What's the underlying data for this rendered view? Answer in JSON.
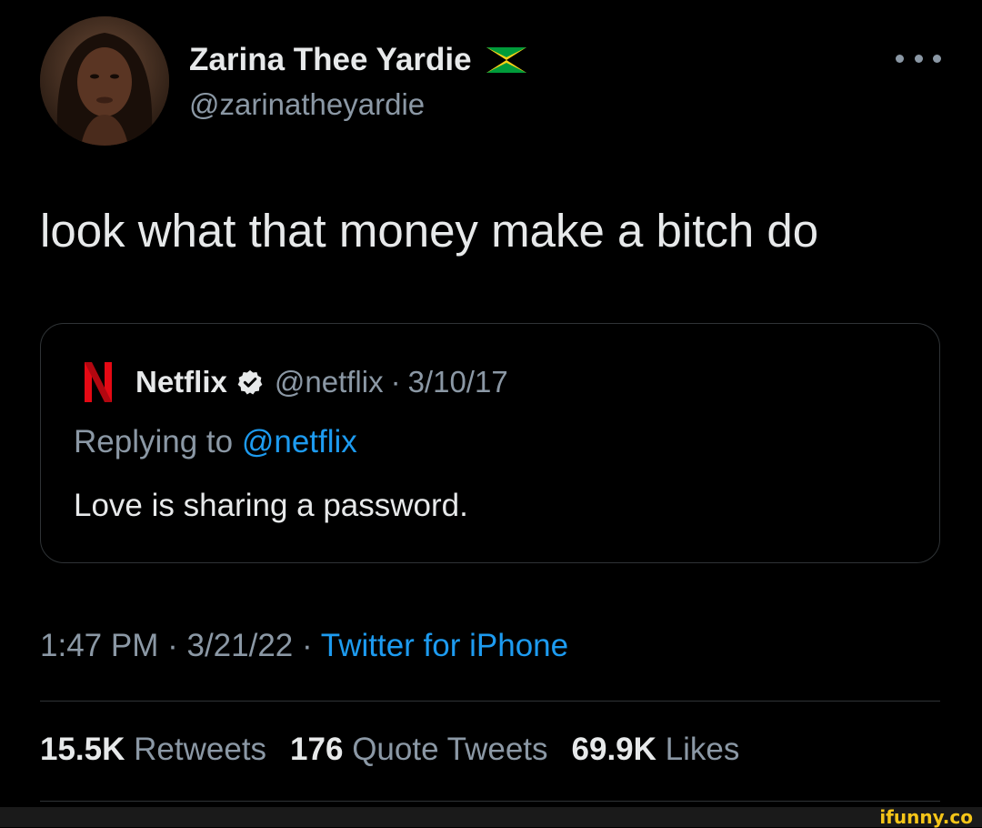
{
  "author": {
    "display_name": "Zarina Thee Yardie",
    "flag_icon": "jamaica-flag-icon",
    "handle": "@zarinatheyardie",
    "avatar_icon": "user-avatar"
  },
  "tweet": {
    "text": "look what that money make a bitch do",
    "time": "1:47 PM",
    "date": "3/21/22",
    "source": "Twitter for iPhone",
    "separator": "·"
  },
  "quoted_tweet": {
    "logo_icon": "netflix-logo-icon",
    "display_name": "Netflix",
    "verified_icon": "verified-badge-icon",
    "handle": "@netflix",
    "date": "3/10/17",
    "replying_prefix": "Replying to",
    "replying_to": "@netflix",
    "text": "Love is sharing a password."
  },
  "stats": {
    "retweets_count": "15.5K",
    "retweets_label": "Retweets",
    "quote_tweets_count": "176",
    "quote_tweets_label": "Quote Tweets",
    "likes_count": "69.9K",
    "likes_label": "Likes"
  },
  "watermark": {
    "text": "ifunny.co"
  },
  "colors": {
    "background": "#000000",
    "primary_text": "#e7e9ea",
    "secondary_text": "#8b98a5",
    "link": "#1d9bf0",
    "border": "#2f3336",
    "netflix_red": "#e50914",
    "watermark_yellow": "#f5c518"
  }
}
